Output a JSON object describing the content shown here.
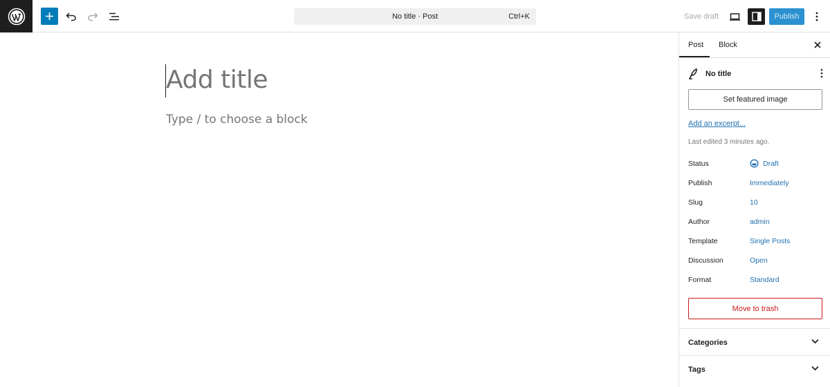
{
  "toolbar": {
    "icons": {
      "logo": "wordpress-logo",
      "add": "plus-icon",
      "undo": "undo-icon",
      "redo": "redo-icon",
      "list_view": "list-view-icon",
      "preview": "desktop-icon",
      "settings": "sidebar-icon",
      "options": "more-vertical-icon"
    },
    "command_title": "No title · Post",
    "command_shortcut": "Ctrl+K",
    "save_draft": "Save draft",
    "publish": "Publish"
  },
  "editor": {
    "title_placeholder": "Add title",
    "block_placeholder": "Type / to choose a block"
  },
  "sidebar": {
    "tabs": [
      {
        "label": "Post",
        "active": true
      },
      {
        "label": "Block",
        "active": false
      }
    ],
    "post_title": "No title",
    "featured_image_button": "Set featured image",
    "excerpt_link": "Add an excerpt...",
    "last_edited": "Last edited 3 minutes ago.",
    "meta": [
      {
        "label": "Status",
        "value": "Draft"
      },
      {
        "label": "Publish",
        "value": "Immediately"
      },
      {
        "label": "Slug",
        "value": "10"
      },
      {
        "label": "Author",
        "value": "admin"
      },
      {
        "label": "Template",
        "value": "Single Posts"
      },
      {
        "label": "Discussion",
        "value": "Open"
      },
      {
        "label": "Format",
        "value": "Standard"
      }
    ],
    "trash_button": "Move to trash",
    "panels": [
      {
        "label": "Categories"
      },
      {
        "label": "Tags"
      }
    ]
  },
  "colors": {
    "accent": "#007cba",
    "link": "#2271b1",
    "danger": "#cc1818",
    "dark": "#1e1e1e"
  }
}
